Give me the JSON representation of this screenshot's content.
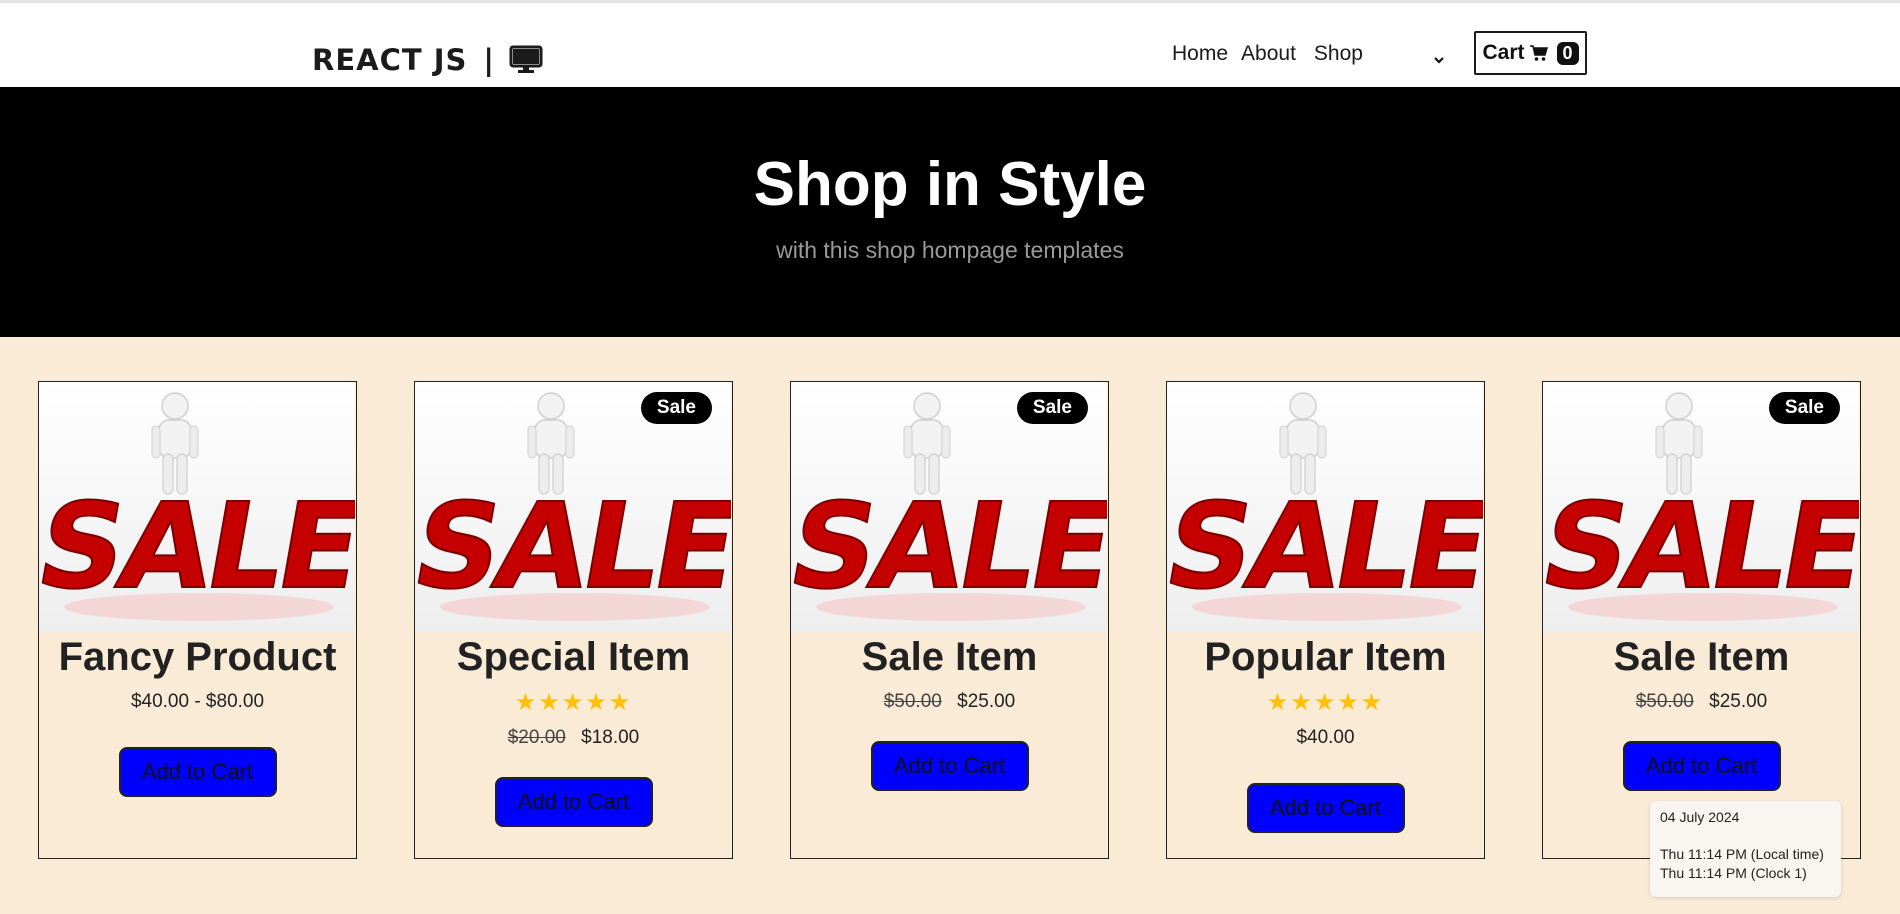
{
  "navbar": {
    "brand_text": "REACT JS",
    "brand_separator": "|",
    "brand_icon": "desktop-monitor-icon",
    "links": [
      {
        "label": "Home"
      },
      {
        "label": "About"
      },
      {
        "label": "Shop"
      }
    ],
    "dropdown_icon": "chevron-down-icon",
    "cart": {
      "label": "Cart",
      "icon": "shopping-cart-icon",
      "count": "0"
    }
  },
  "hero": {
    "title": "Shop in Style",
    "subtitle": "with this shop hompage templates"
  },
  "products": [
    {
      "title": "Fancy Product",
      "sale_badge": "",
      "rating": 0,
      "old_price": "",
      "price": "$40.00 - $80.00",
      "button": "Add to Cart"
    },
    {
      "title": "Special Item",
      "sale_badge": "Sale",
      "rating": 5,
      "old_price": "$20.00",
      "price": "$18.00",
      "button": "Add to Cart"
    },
    {
      "title": "Sale Item",
      "sale_badge": "Sale",
      "rating": 0,
      "old_price": "$50.00",
      "price": "$25.00",
      "button": "Add to Cart"
    },
    {
      "title": "Popular Item",
      "sale_badge": "",
      "rating": 5,
      "old_price": "",
      "price": "$40.00",
      "button": "Add to Cart"
    },
    {
      "title": "Sale Item",
      "sale_badge": "Sale",
      "rating": 0,
      "old_price": "$50.00",
      "price": "$25.00",
      "button": "Add to Cart"
    }
  ],
  "image_text": "SALE",
  "clock_popup": {
    "date": "04 July 2024",
    "local_time": "Thu 11:14 PM (Local time)",
    "clock1_time": "Thu 11:14 PM (Clock 1)"
  },
  "colors": {
    "page_bg": "#faebd7",
    "hero_bg": "#000000",
    "button_bg": "#0000ff",
    "star": "#ffc107",
    "sale_red": "#c40000"
  }
}
